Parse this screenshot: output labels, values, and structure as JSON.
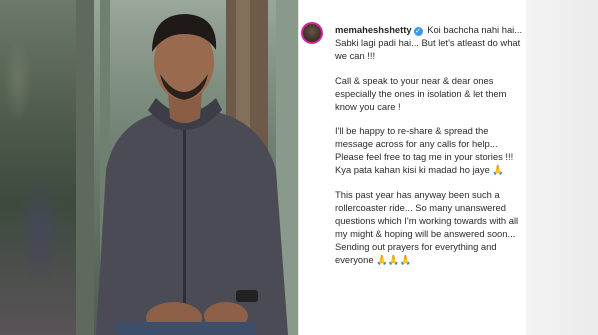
{
  "post": {
    "username": "memaheshshetty",
    "verified_icon": "verified-badge-icon",
    "caption_intro": "Koi bachcha nahi hai... Sabki lagi padi hai... But let's atleast do what we can !!!",
    "paragraph_2": "Call & speak to your near & dear ones especially the ones in isolation & let them know you care !",
    "paragraph_3": "I'll be happy to re-share & spread the message across for any calls for help... Please feel free to tag me in your stories !!!",
    "paragraph_3b": "Kya pata kahan kisi ki madad ho jaye 🙏",
    "paragraph_4": "This past year has anyway been such a rollercoaster ride... So many unanswered questions which I'm working towards with all my might & hoping will be answered soon... Sending out prayers for everything and everyone 🙏🙏🙏"
  },
  "colors": {
    "avatar_ring": "#d6249f",
    "verified": "#3897f0",
    "text": "#262626"
  }
}
